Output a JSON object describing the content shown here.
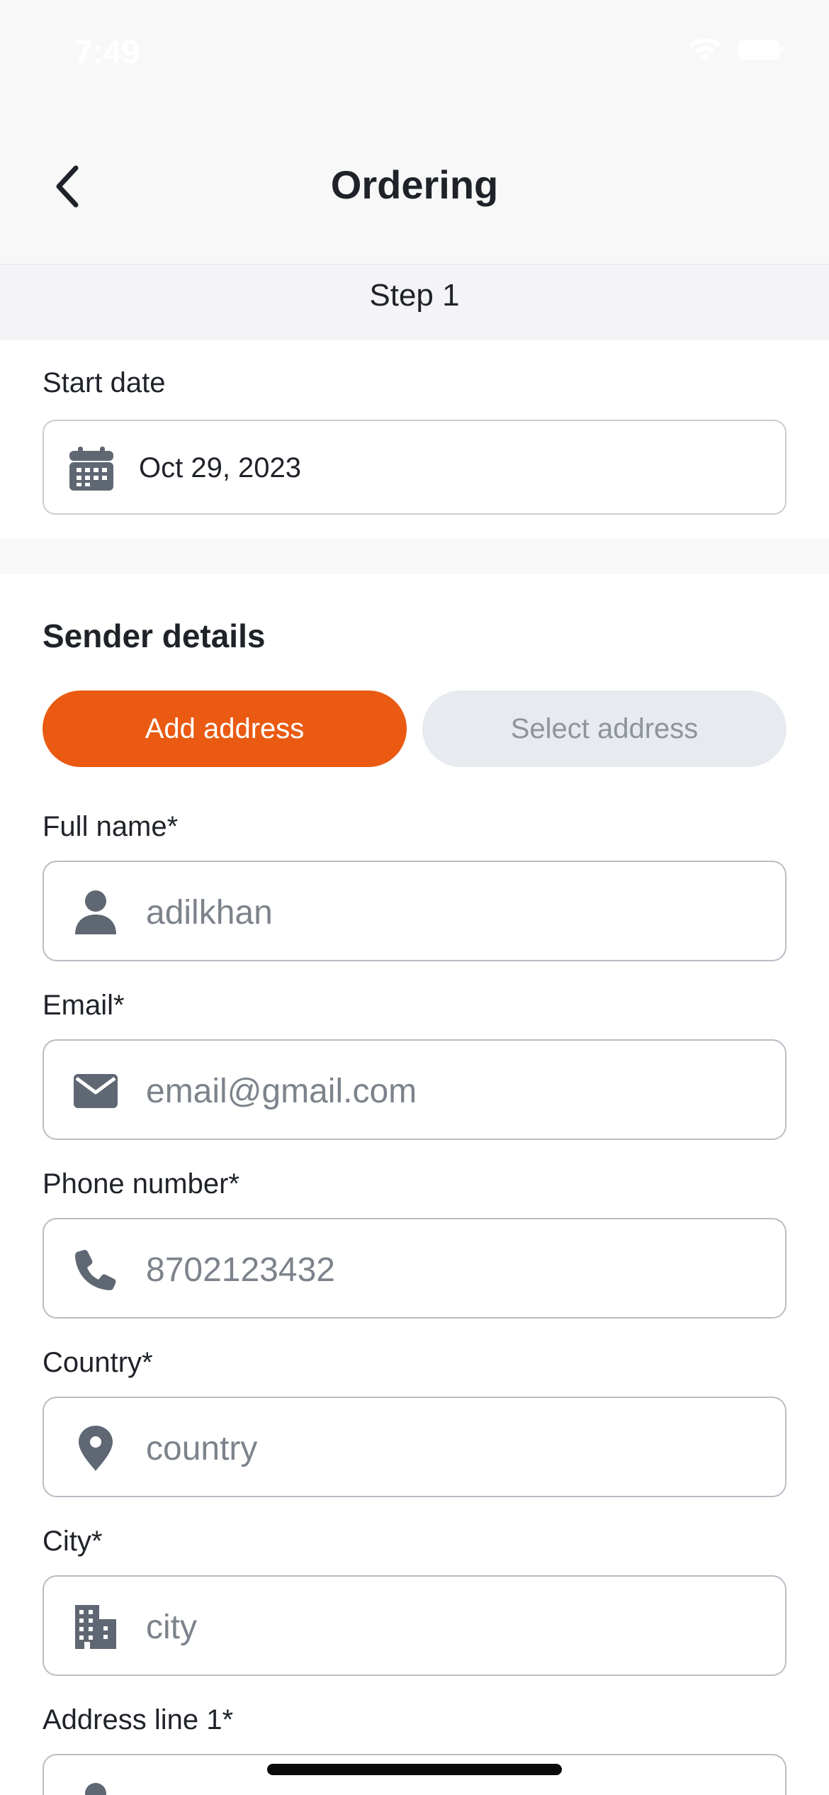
{
  "status_bar": {
    "time": "7:49"
  },
  "header": {
    "title": "Ordering"
  },
  "step": {
    "label": "Step 1"
  },
  "start_date": {
    "label": "Start date",
    "value": "Oct 29, 2023"
  },
  "sender": {
    "title": "Sender details",
    "add_address_label": "Add address",
    "select_address_label": "Select address",
    "fields": {
      "full_name": {
        "label": "Full name*",
        "value": "adilkhan"
      },
      "email": {
        "label": "Email*",
        "placeholder": "email@gmail.com"
      },
      "phone": {
        "label": "Phone number*",
        "value": "8702123432"
      },
      "country": {
        "label": "Country*",
        "placeholder": "country"
      },
      "city": {
        "label": "City*",
        "placeholder": "city"
      },
      "address_line1": {
        "label": "Address line 1*"
      }
    }
  },
  "colors": {
    "accent": "#ea5a12",
    "icon_gray": "#5f6773",
    "placeholder": "#7d838c",
    "segment_inactive_bg": "#e7eaee"
  },
  "icons": {
    "back": "chevron-left-icon",
    "date": "calendar-icon",
    "full_name": "person-icon",
    "email": "envelope-icon",
    "phone": "phone-icon",
    "country": "map-pin-icon",
    "city": "building-icon"
  }
}
